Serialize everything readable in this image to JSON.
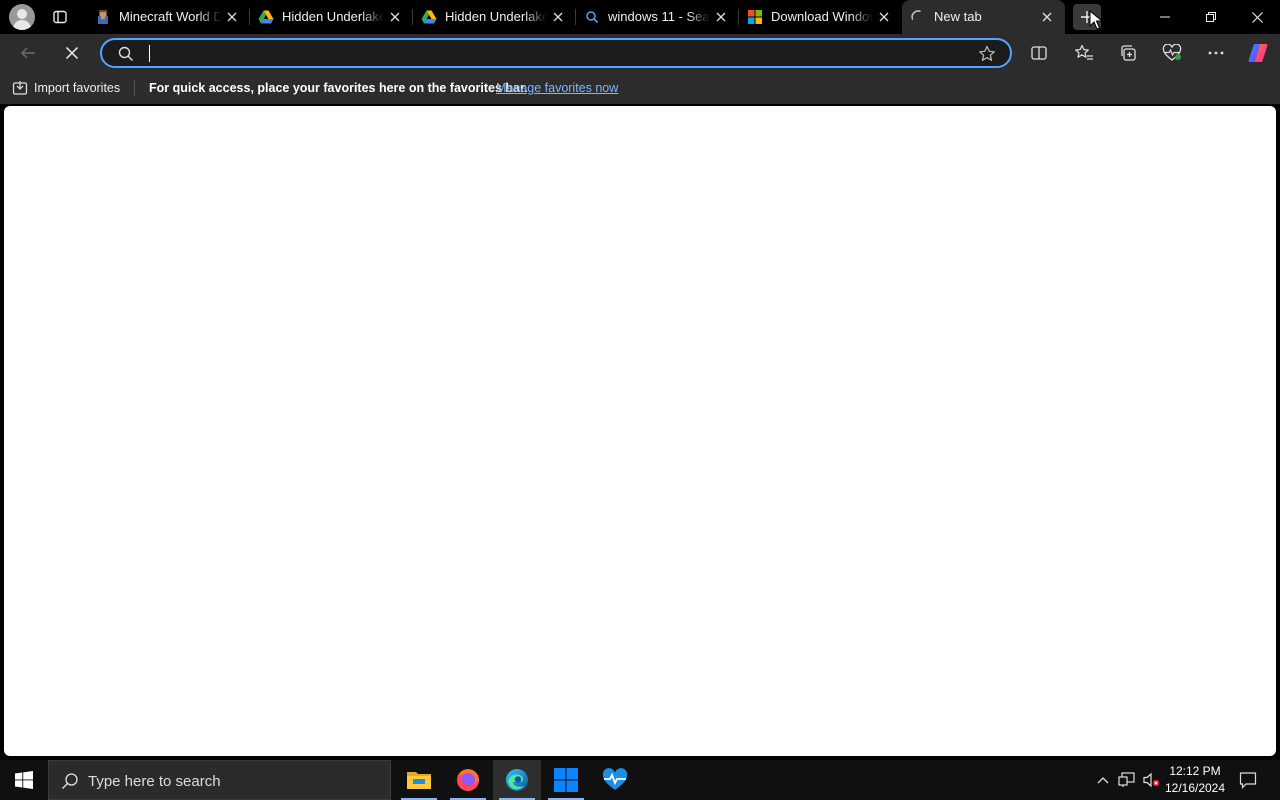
{
  "tabs": [
    {
      "title": "Minecraft World Download",
      "icon": "minecraft-icon",
      "active": false
    },
    {
      "title": "Hidden Underlake World",
      "icon": "google-drive-icon",
      "active": false
    },
    {
      "title": "Hidden Underlake World",
      "icon": "google-drive-icon",
      "active": false
    },
    {
      "title": "windows 11 - Search",
      "icon": "search-icon",
      "active": false
    },
    {
      "title": "Download Windows 11",
      "icon": "microsoft-icon",
      "active": false
    },
    {
      "title": "New tab",
      "icon": "loading-spinner-icon",
      "active": true
    }
  ],
  "omnibox": {
    "value": "",
    "placeholder": ""
  },
  "favorites_bar": {
    "import_label": "Import favorites",
    "message": "For quick access, place your favorites here on the favorites bar.",
    "link": "Manage favorites now"
  },
  "taskbar": {
    "search_placeholder": "Type here to search",
    "apps": [
      "file-explorer-icon",
      "firefox-icon",
      "edge-icon",
      "windows-store-icon",
      "health-monitor-icon"
    ],
    "time": "12:12 PM",
    "date": "12/16/2024"
  },
  "colors": {
    "accent": "#4aa8ff",
    "link": "#7cb8ff",
    "chrome": "#2c2c2c",
    "tabstrip": "#000000",
    "page": "#ffffff"
  }
}
